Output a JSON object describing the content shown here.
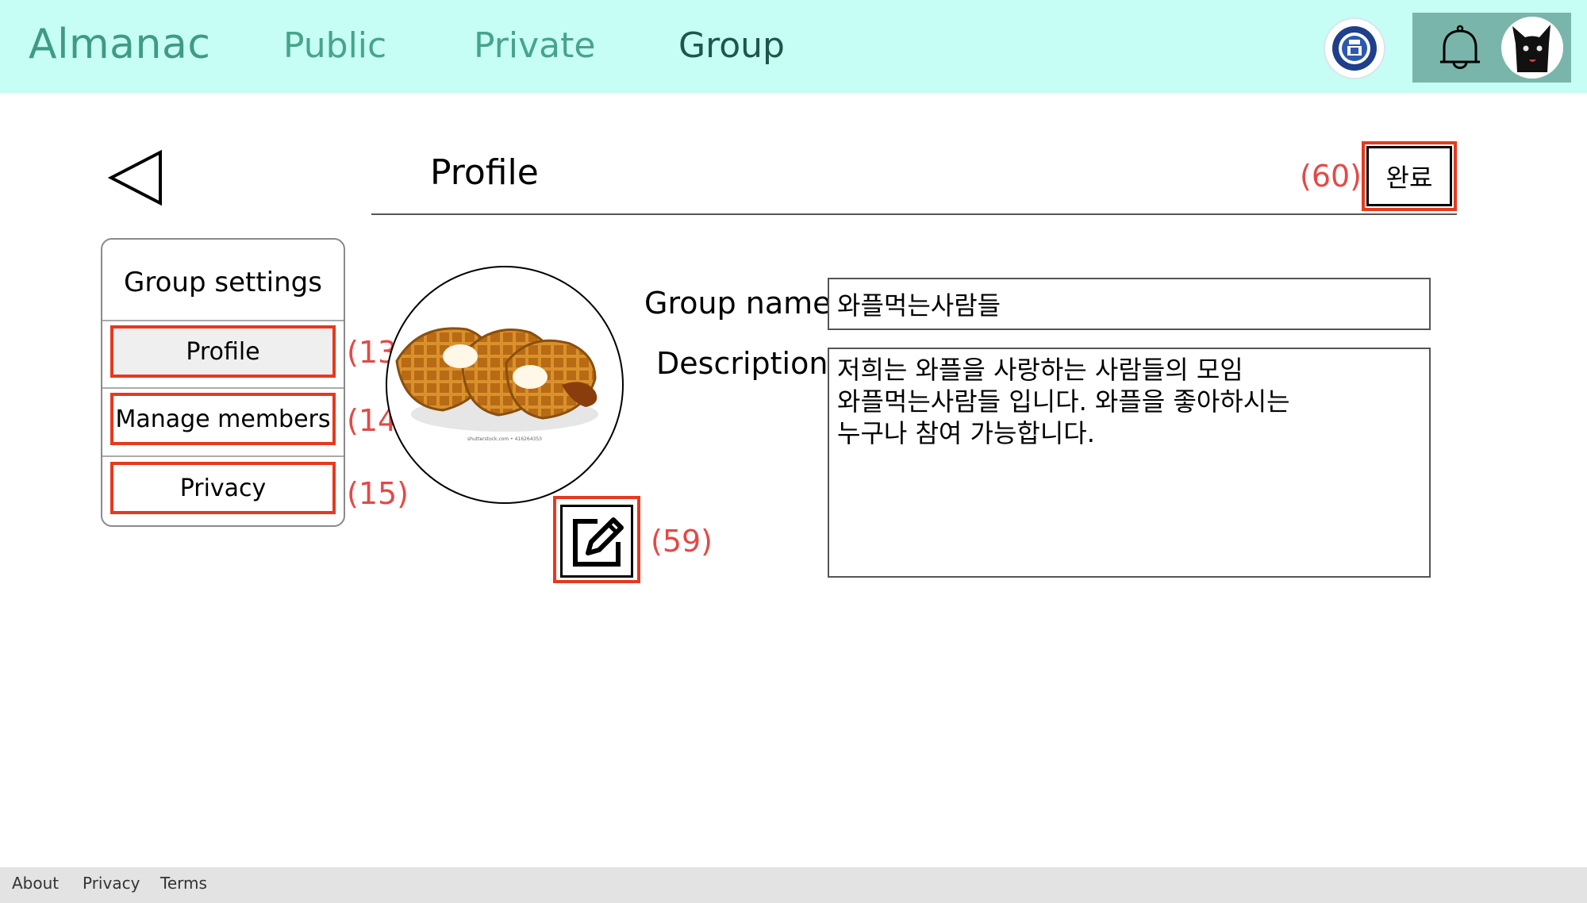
{
  "app": {
    "brand": "Almanac"
  },
  "nav": {
    "items": [
      {
        "label": "Public",
        "active": false
      },
      {
        "label": "Private",
        "active": false
      },
      {
        "label": "Group",
        "active": true
      }
    ]
  },
  "header": {
    "title": "Profile",
    "done_label": "완료",
    "icons": {
      "back": "back-triangle-icon",
      "bell": "bell-icon",
      "avatar": "black-cat-avatar",
      "logo": "university-logo"
    }
  },
  "annotations": {
    "done": "(60)",
    "profile": "(13)",
    "manage_members": "(14)",
    "privacy": "(15)",
    "edit_image": "(59)"
  },
  "sidebar": {
    "title": "Group settings",
    "items": [
      {
        "label": "Profile",
        "selected": true
      },
      {
        "label": "Manage members",
        "selected": false
      },
      {
        "label": "Privacy",
        "selected": false
      }
    ]
  },
  "profile": {
    "image": {
      "subject": "waffles-image",
      "caption": "shutterstock.com • 416264353"
    },
    "edit_icon": "edit-pencil-icon",
    "group_name_label": "Group name:",
    "group_name_value": "와플먹는사람들",
    "description_label": "Description:",
    "description_value": "저희는 와플을 사랑하는 사람들의 모임\n와플먹는사람들 입니다. 와플을 좋아하시는\n누구나 참여 가능합니다."
  },
  "footer": {
    "links": [
      "About",
      "Privacy",
      "Terms"
    ]
  },
  "colors": {
    "topbar": "#c6fdf5",
    "brand": "#3f9a83",
    "nav_active": "#1e5647",
    "user_box": "#7ab5ab",
    "annotation_red": "#e24a46",
    "highlight_frame": "#e6391e"
  }
}
